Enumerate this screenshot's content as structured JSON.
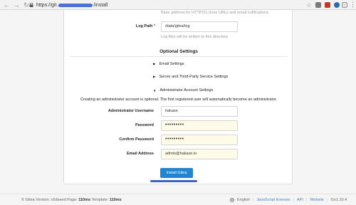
{
  "browser": {
    "url_prefix": "https://git.",
    "url_suffix": "/install"
  },
  "form": {
    "domain_helper": "Base address for HTTP(S) clone URLs and email notifications.",
    "log_path_label": "Log Path",
    "log_path_value": "/data/gitea/log",
    "log_path_helper": "Log files will be written to this directory.",
    "optional_title": "Optional Settings",
    "email_settings": "Email Settings",
    "server_settings": "Server and Third-Party Service Settings",
    "admin_settings": "Administrator Account Settings",
    "admin_note": "Creating an administrator account is optional. The first registered user will automatically become an administrator.",
    "admin_username_label": "Administrator Username",
    "admin_username_value": "hakase",
    "password_label": "Password",
    "password_value": "•••••••••",
    "confirm_password_label": "Confirm Password",
    "confirm_password_value": "•••••••••",
    "email_label": "Email Address",
    "email_value": "admin@hakase.io",
    "install_button": "Install Gitea"
  },
  "footer": {
    "version_prefix": "© Gitea Version: c6daeed Page: ",
    "page_time": "110ms",
    "template_prefix": " Template: ",
    "template_time": "110ms",
    "language": "English",
    "js_licenses": "JavaScript licenses",
    "api": "API",
    "website": "Website",
    "go_version": "Go1.10.4"
  },
  "colors": {
    "primary_button": "#2185d0",
    "link": "#4183c4",
    "required": "#db2828"
  }
}
